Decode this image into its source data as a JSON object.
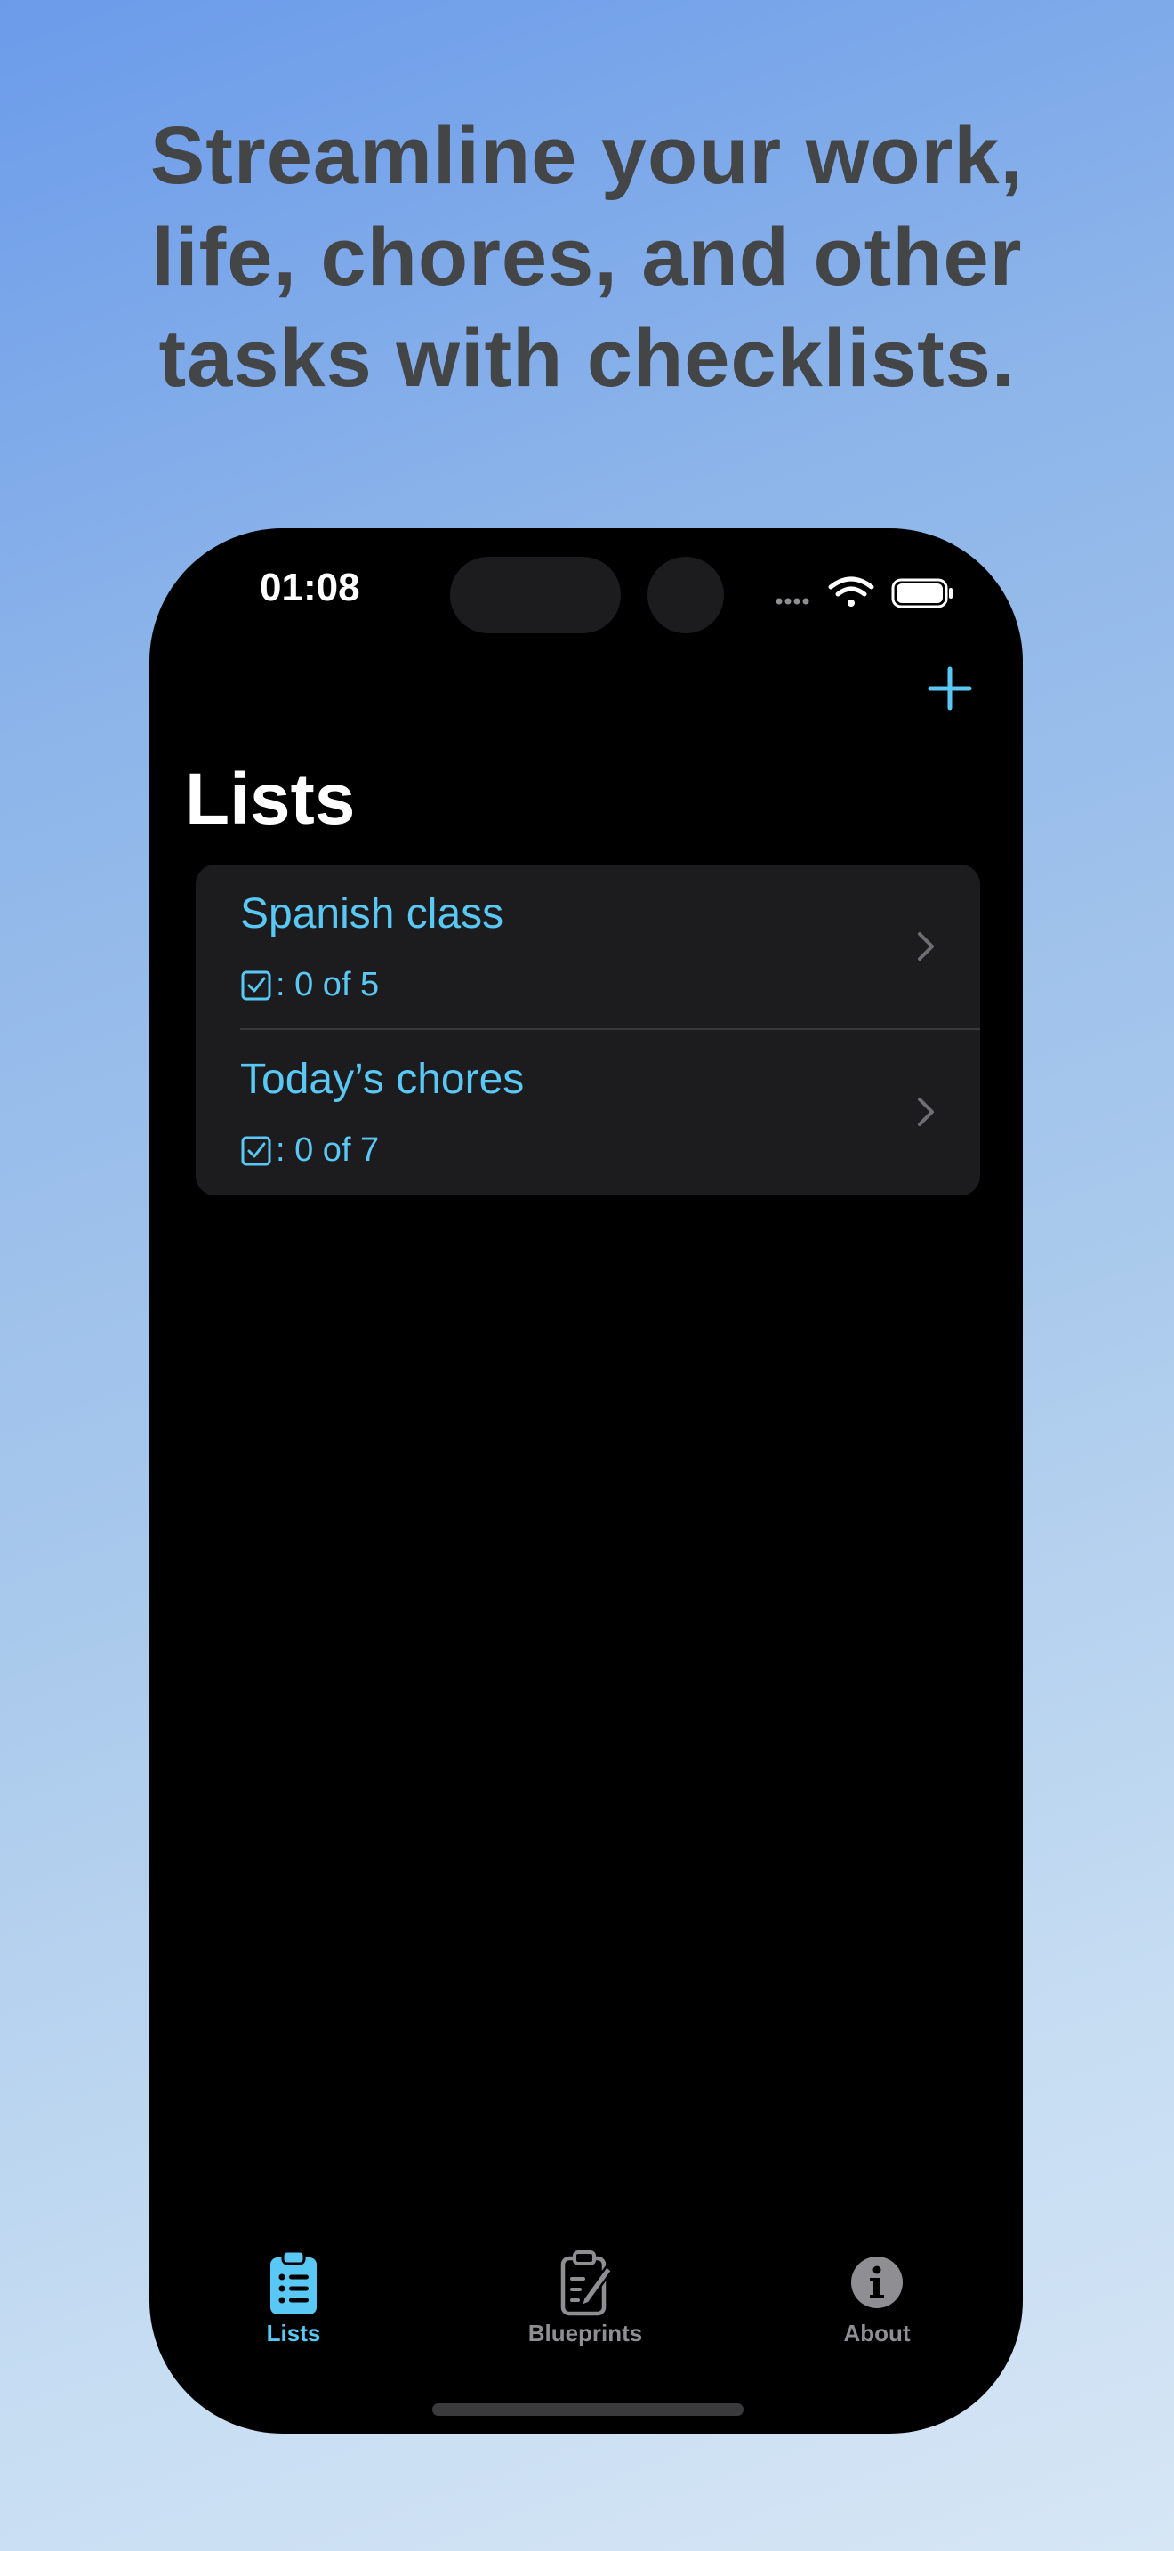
{
  "headline": "Streamline your work,\nlife, chores, and other\ntasks with checklists.",
  "status_bar": {
    "time": "01:08",
    "icons": [
      "signal-dots-icon",
      "wifi-icon",
      "battery-icon"
    ]
  },
  "nav": {
    "add_icon": "plus-icon",
    "title": "Lists"
  },
  "lists": [
    {
      "title": "Spanish class",
      "progress": ": 0 of 5",
      "icon": "checkbox-icon"
    },
    {
      "title": "Today’s chores",
      "progress": ": 0 of 7",
      "icon": "checkbox-icon"
    }
  ],
  "tabs": [
    {
      "label": "Lists",
      "icon": "clipboard-list-icon",
      "active": true
    },
    {
      "label": "Blueprints",
      "icon": "clipboard-pencil-icon",
      "active": false
    },
    {
      "label": "About",
      "icon": "info-circle-icon",
      "active": false
    }
  ],
  "colors": {
    "accent": "#5ac8f5",
    "headline_text": "#444547",
    "card_background": "#1c1c1e",
    "inactive_tab": "#8e8e93"
  }
}
